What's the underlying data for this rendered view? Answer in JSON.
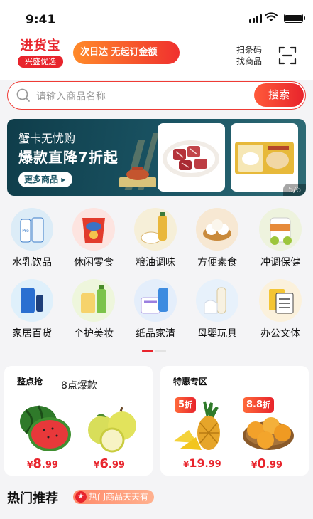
{
  "status": {
    "time": "9:41"
  },
  "header": {
    "logo_main": "进货宝",
    "logo_sub": "兴盛优选",
    "promo": "次日达 无起订金额",
    "scan_line1": "扫条码",
    "scan_line2": "找商品"
  },
  "search": {
    "placeholder": "请输入商品名称",
    "button": "搜索"
  },
  "banner": {
    "line1": "蟹卡无忧购",
    "line2": "爆款直降7折起",
    "more": "更多商品",
    "pager": "5/6"
  },
  "categories": [
    {
      "label": "水乳饮品",
      "icon": "milk-icon"
    },
    {
      "label": "休闲零食",
      "icon": "snack-icon"
    },
    {
      "label": "粮油调味",
      "icon": "oil-icon"
    },
    {
      "label": "方便素食",
      "icon": "dumpling-icon"
    },
    {
      "label": "冲调保健",
      "icon": "supplement-icon"
    },
    {
      "label": "家居百货",
      "icon": "household-icon"
    },
    {
      "label": "个护美妆",
      "icon": "personal-care-icon"
    },
    {
      "label": "纸品家清",
      "icon": "paper-icon"
    },
    {
      "label": "母婴玩具",
      "icon": "baby-icon"
    },
    {
      "label": "办公文体",
      "icon": "office-icon"
    }
  ],
  "flash": {
    "title": "整点抢",
    "subtitle": "8点爆款",
    "items": [
      {
        "price_int": "8",
        "price_dec": ".99",
        "icon": "watermelon-icon"
      },
      {
        "price_int": "6",
        "price_dec": ".99",
        "icon": "pear-icon"
      }
    ]
  },
  "special": {
    "title": "特惠专区",
    "items": [
      {
        "discount": "5",
        "unit": "折",
        "price_int": "19",
        "price_dec": ".99",
        "icon": "pineapple-icon"
      },
      {
        "discount": "8.8",
        "unit": "折",
        "price_int": "0",
        "price_dec": ".99",
        "icon": "mango-icon"
      }
    ]
  },
  "currency": "¥",
  "hot": {
    "title": "热门推荐",
    "badge": "热门商品天天有"
  },
  "colors": {
    "brand": "#e8242c",
    "promo_start": "#ff8a2a",
    "banner_bg": "#1a5464"
  }
}
